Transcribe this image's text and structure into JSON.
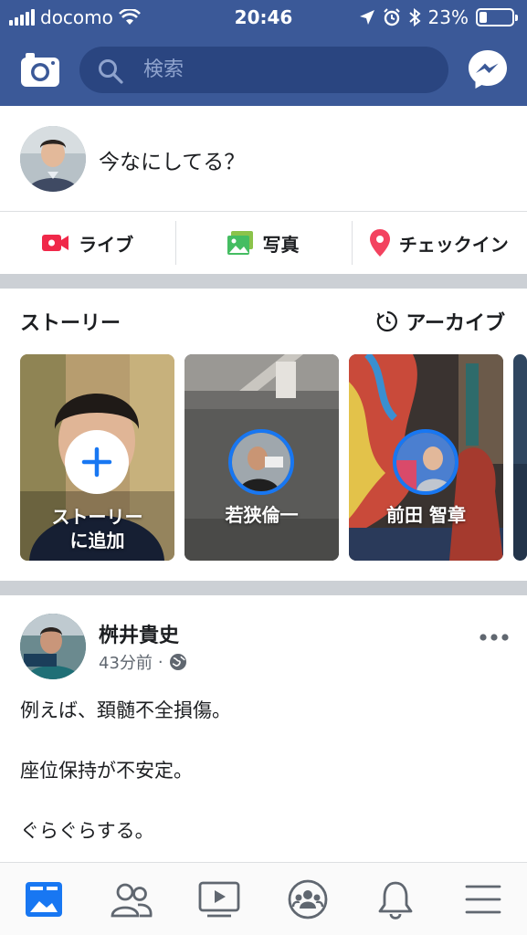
{
  "status_bar": {
    "carrier": "docomo",
    "time": "20:46",
    "battery": "23%",
    "battery_level": 0.23
  },
  "header": {
    "search_placeholder": "検索",
    "icons": [
      "camera-icon",
      "search-icon",
      "messenger-icon"
    ]
  },
  "composer": {
    "prompt": "今なにしてる？",
    "actions": [
      {
        "label": "ライブ",
        "icon": "live-video-icon",
        "color": "#f02849"
      },
      {
        "label": "写真",
        "icon": "photo-icon",
        "color": "#45bd62"
      },
      {
        "label": "チェックイン",
        "icon": "location-pin-icon",
        "color": "#f3425f"
      }
    ]
  },
  "stories": {
    "title": "ストーリー",
    "archive_label": "アーカイブ",
    "add_story_label_line1": "ストーリー",
    "add_story_label_line2": "に追加",
    "items": [
      {
        "name": "若狭倫一"
      },
      {
        "name": "前田 智章"
      }
    ]
  },
  "post": {
    "author": "桝井貴史",
    "time": "43分前",
    "privacy_icon": "globe-icon",
    "lines": [
      "例えば、頚髄不全損傷。",
      "座位保持が不安定。",
      "ぐらぐらする。"
    ]
  },
  "tabbar": {
    "tabs": [
      "news-feed-icon",
      "friends-icon",
      "watch-icon",
      "groups-icon",
      "notifications-icon",
      "menu-icon"
    ],
    "active_color": "#1877f2"
  }
}
